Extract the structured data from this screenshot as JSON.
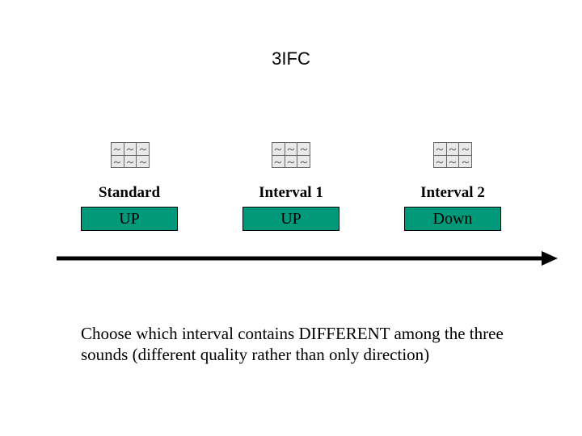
{
  "title": "3IFC",
  "columns": [
    {
      "label": "Standard",
      "button": "UP"
    },
    {
      "label": "Interval 1",
      "button": "UP"
    },
    {
      "label": "Interval 2",
      "button": "Down"
    }
  ],
  "instruction": "Choose which interval contains DIFFERENT among the three sounds (different quality rather than only direction)",
  "icon_name": "image-grid-icon",
  "colors": {
    "button_bg": "#009a7a"
  }
}
